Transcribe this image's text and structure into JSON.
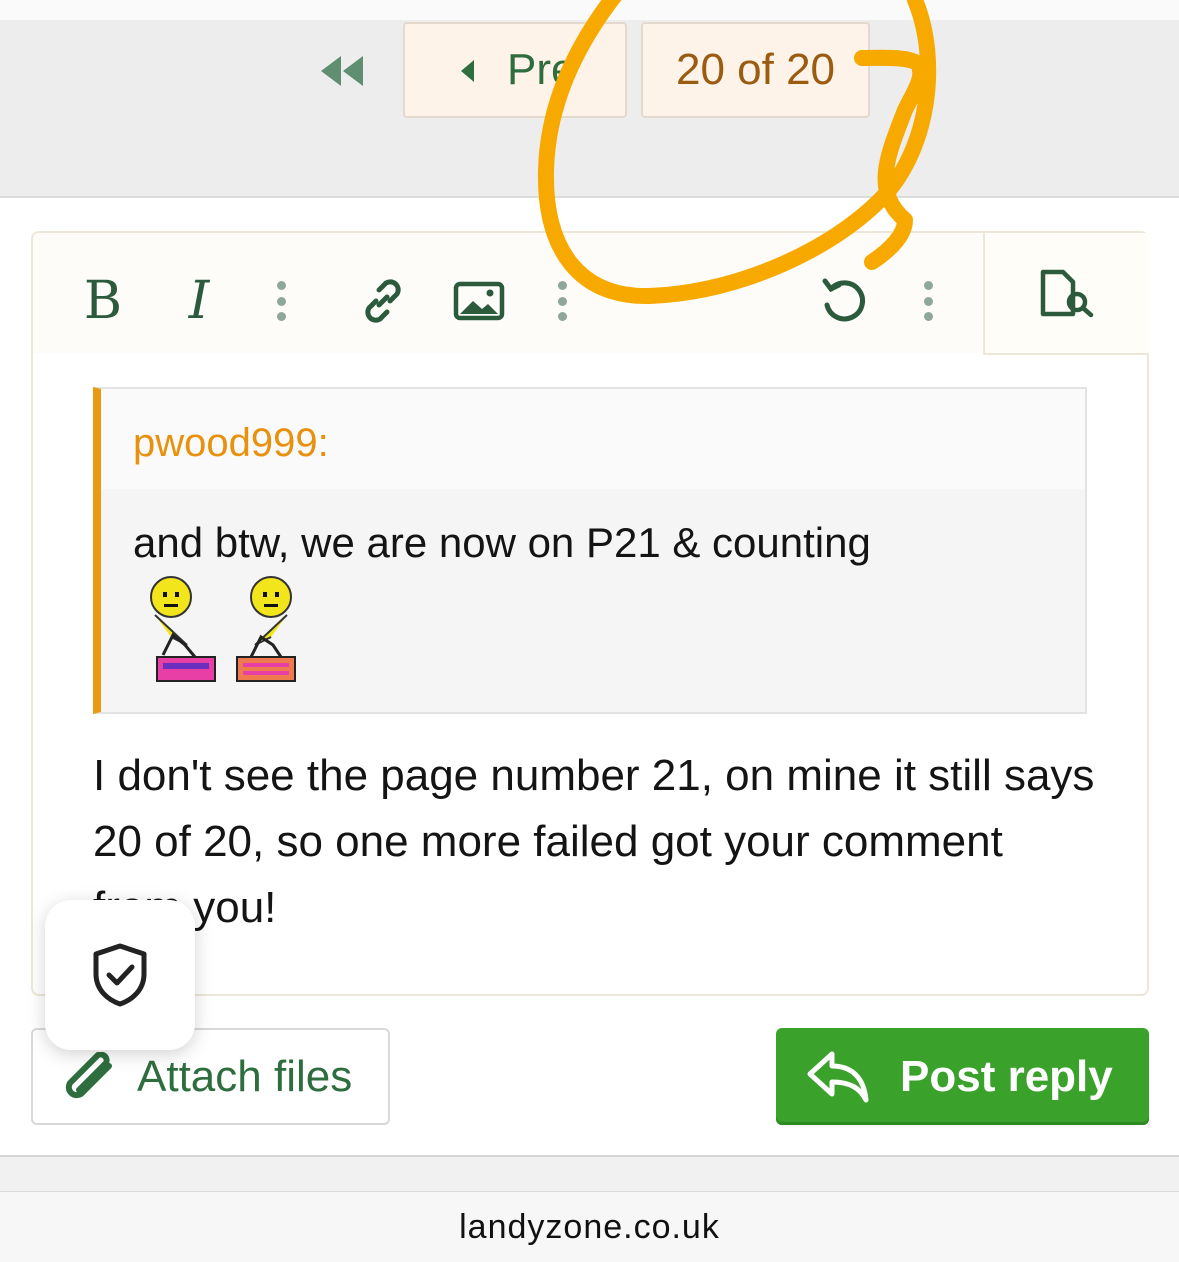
{
  "pagination": {
    "prev_label": "Pre",
    "current_label": "20 of 20"
  },
  "editor": {
    "toolbar": {
      "bold_label": "B",
      "italic_label": "I"
    },
    "quote": {
      "author": "pwood999:",
      "text": "and btw, we are now on P21 & counting"
    },
    "message": "I don't see the page number 21, on mine it still says 20 of 20, so one more failed got your comment from you!"
  },
  "actions": {
    "attach_label": "Attach files",
    "post_label": "Post reply"
  },
  "browser": {
    "url": "landyzone.co.uk"
  },
  "colors": {
    "accent_green": "#2e6e3e",
    "post_green": "#3aa12b",
    "quote_orange": "#e89a12",
    "annotation_orange": "#f8a900"
  },
  "icons": {
    "first_page": "double-chevron-left-icon",
    "prev": "triangle-left-icon",
    "link": "link-icon",
    "image": "image-icon",
    "undo": "undo-icon",
    "preview": "document-search-icon",
    "shield": "shield-check-icon",
    "attach": "paperclip-icon",
    "reply": "reply-arrow-icon"
  }
}
